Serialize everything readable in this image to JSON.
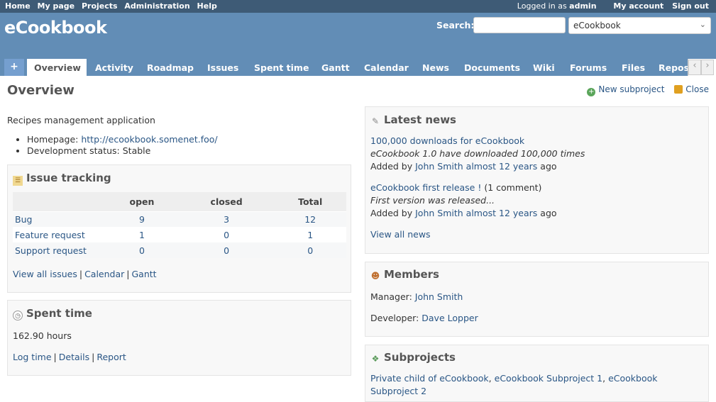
{
  "top_menu": {
    "items": [
      "Home",
      "My page",
      "Projects",
      "Administration",
      "Help"
    ],
    "logged_as_prefix": "Logged in as",
    "user": "admin",
    "my_account": "My account",
    "sign_out": "Sign out"
  },
  "header": {
    "title": "eCookbook",
    "search_label": "Search:",
    "search_value": "",
    "project_jump": "eCookbook"
  },
  "tabs": {
    "plus": "+",
    "items": [
      "Overview",
      "Activity",
      "Roadmap",
      "Issues",
      "Spent time",
      "Gantt",
      "Calendar",
      "News",
      "Documents",
      "Wiki",
      "Forums",
      "Files",
      "Repository"
    ],
    "selected": "Overview"
  },
  "content": {
    "title": "Overview",
    "new_subproject": "New subproject",
    "close": "Close",
    "description": "Recipes management application",
    "homepage_label": "Homepage:",
    "homepage_url": "http://ecookbook.somenet.foo/",
    "dev_status_label": "Development status:",
    "dev_status_value": "Stable"
  },
  "issue_tracking": {
    "title": "Issue tracking",
    "columns": [
      "",
      "open",
      "closed",
      "Total"
    ],
    "rows": [
      {
        "name": "Bug",
        "open": "9",
        "closed": "3",
        "total": "12"
      },
      {
        "name": "Feature request",
        "open": "1",
        "closed": "0",
        "total": "1"
      },
      {
        "name": "Support request",
        "open": "0",
        "closed": "0",
        "total": "0"
      }
    ],
    "links": [
      "View all issues",
      "Calendar",
      "Gantt"
    ],
    "separator": "|"
  },
  "spent_time": {
    "title": "Spent time",
    "hours": "162.90 hours",
    "links": [
      "Log time",
      "Details",
      "Report"
    ],
    "separator": "|"
  },
  "latest_news": {
    "title": "Latest news",
    "items": [
      {
        "title": "100,000 downloads for eCookbook",
        "comments": "",
        "summary": "eCookbook 1.0 have downloaded 100,000 times",
        "added_by": "Added by",
        "author": "John Smith",
        "when": "almost 12 years",
        "ago": "ago"
      },
      {
        "title": "eCookbook first release !",
        "comments": "(1 comment)",
        "summary": "First version was released...",
        "added_by": "Added by",
        "author": "John Smith",
        "when": "almost 12 years",
        "ago": "ago"
      }
    ],
    "view_all": "View all news"
  },
  "members": {
    "title": "Members",
    "manager_label": "Manager:",
    "manager": "John Smith",
    "developer_label": "Developer:",
    "developer": "Dave Lopper"
  },
  "subprojects": {
    "title": "Subprojects",
    "items": [
      "Private child of eCookbook",
      "eCookbook Subproject 1",
      "eCookbook Subproject 2"
    ],
    "separator": ","
  },
  "colors": {
    "top_menu_bg": "#3e5b76",
    "header_bg": "#628db6",
    "tab_plus_bg": "#759fcf",
    "link": "#2a5685",
    "box_bg": "#f8f8f8"
  }
}
